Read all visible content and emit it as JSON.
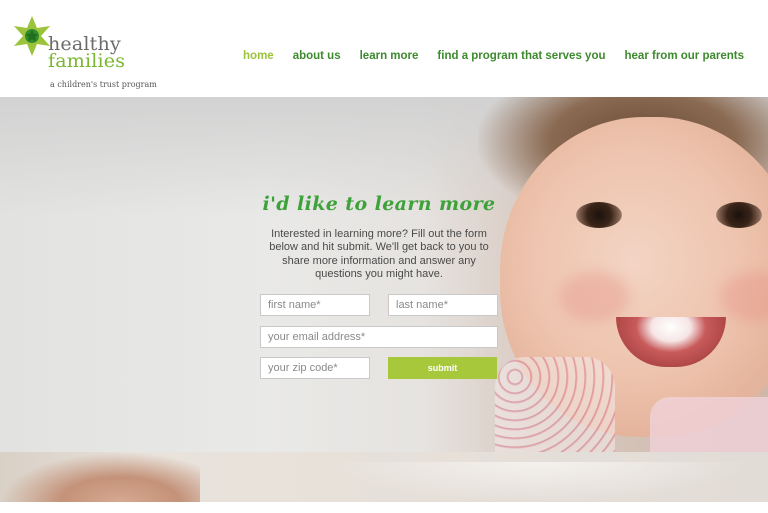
{
  "brand": {
    "line1": "healthy",
    "line2": "families",
    "tagline": "a children's trust program",
    "colors": {
      "green": "#3ea23b",
      "lime": "#a8c83c",
      "navActive": "#9cc43a"
    }
  },
  "nav": {
    "items": [
      {
        "label": "home"
      },
      {
        "label": "about us"
      },
      {
        "label": "learn more"
      },
      {
        "label": "find a program that serves you"
      },
      {
        "label": "hear from our parents"
      }
    ]
  },
  "form": {
    "title": "i'd like to learn more",
    "intro": "Interested in learning more? Fill out the form below and hit submit. We'll get back to you to share more information and answer any questions you might have.",
    "first_name_placeholder": "first name*",
    "last_name_placeholder": "last name*",
    "email_placeholder": "your email address*",
    "zip_placeholder": "your zip code*",
    "submit_label": "submit"
  }
}
